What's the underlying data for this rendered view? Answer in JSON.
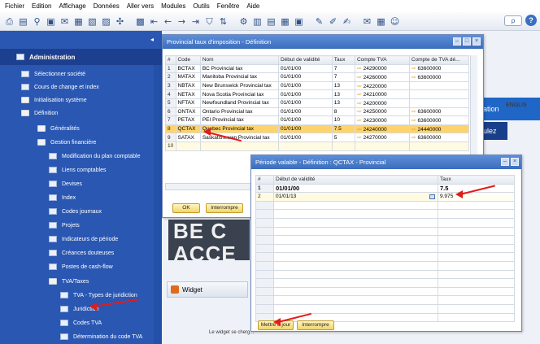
{
  "menu": [
    "Fichier",
    "Edition",
    "Affichage",
    "Données",
    "Aller vers",
    "Modules",
    "Outils",
    "Fenêtre",
    "Aide"
  ],
  "toolbar": {
    "icons": [
      "print-icon",
      "print-preview-icon",
      "find-icon",
      "add-icon",
      "mail-icon",
      "document-icon",
      "document-icon",
      "document-icon",
      "filter-icon",
      "first-record-icon",
      "previous-record-icon",
      "next-record-icon",
      "last-record-icon",
      "filter-funnel-icon",
      "sort-icon",
      "settings-icon",
      "report-icon",
      "chart-icon",
      "edit-icon",
      "note-icon",
      "message-icon",
      "calendar-icon",
      "user-icon"
    ],
    "search_value": "ρ"
  },
  "nav": {
    "collapse_glyph": "◂",
    "header": "Administration",
    "items": [
      "Sélectionner société",
      "Cours de change et index",
      "Initialisation système",
      "Définition",
      "Généralités",
      "Gestion financière",
      "Modification du plan comptable",
      "Liens comptables",
      "Devises",
      "Index",
      "Codes journaux",
      "Projets",
      "Indicateurs de période",
      "Créances douteuses",
      "Postes de cash-flow",
      "TVA/Taxes",
      "TVA - Types de juridiction",
      "Juridiction",
      "Codes TVA",
      "Détermination du code TVA"
    ]
  },
  "background": {
    "blue_tile_text": "ation",
    "english_text": "ENGLIS",
    "dark_tile_text": "ulez",
    "banner_text": "BE C ACCE",
    "widget_title": "Widget",
    "note_text": "Le widget se cherg..."
  },
  "win1": {
    "title": "Provincial taux d'imposition - Définition",
    "columns": [
      "#",
      "Code",
      "Nom",
      "Début de validité",
      "Taux",
      "Compte TVA",
      "Compte de TVA dé..."
    ],
    "rows": [
      {
        "n": "1",
        "code": "BCTAX",
        "nom": "BC Provincial tax",
        "debut": "01/01/00",
        "taux": "7",
        "compte": "24290000",
        "compte2": "63600000"
      },
      {
        "n": "2",
        "code": "MATAX",
        "nom": "Manitoba Provincial tax",
        "debut": "01/01/00",
        "taux": "7",
        "compte": "24260000",
        "compte2": "63600000"
      },
      {
        "n": "3",
        "code": "NBTAX",
        "nom": "New Brunswick Provincial tax",
        "debut": "01/01/00",
        "taux": "13",
        "compte": "24220000",
        "compte2": ""
      },
      {
        "n": "4",
        "code": "NETAX",
        "nom": "Nova Scotia Provincial tax",
        "debut": "01/01/00",
        "taux": "13",
        "compte": "24210000",
        "compte2": ""
      },
      {
        "n": "5",
        "code": "NFTAX",
        "nom": "Newfoundland Provincial tax",
        "debut": "01/01/00",
        "taux": "13",
        "compte": "24200000",
        "compte2": ""
      },
      {
        "n": "6",
        "code": "ONTAX",
        "nom": "Ontario Provincial tax",
        "debut": "01/01/00",
        "taux": "8",
        "compte": "24250000",
        "compte2": "63600000"
      },
      {
        "n": "7",
        "code": "PETAX",
        "nom": "PEI Provincial tax",
        "debut": "01/01/00",
        "taux": "10",
        "compte": "24230000",
        "compte2": "63600000"
      },
      {
        "n": "8",
        "code": "QCTAX",
        "nom": "Quebec Provincial tax",
        "debut": "01/01/00",
        "taux": "7.5",
        "compte": "24240000",
        "compte2": "24440000"
      },
      {
        "n": "9",
        "code": "SATAX",
        "nom": "Saskatchewan Provincial tax",
        "debut": "01/01/00",
        "taux": "5",
        "compte": "24270000",
        "compte2": "63600000"
      },
      {
        "n": "10",
        "code": "",
        "nom": "",
        "debut": "",
        "taux": "",
        "compte": "",
        "compte2": ""
      }
    ],
    "ok_label": "OK",
    "cancel_label": "Interrompre"
  },
  "win2": {
    "title": "Période valable - Définition : QCTAX - Provincial",
    "columns": [
      "#",
      "Début de validité",
      "Taux"
    ],
    "rows": [
      {
        "n": "1",
        "debut": "01/01/00",
        "taux": "7.5"
      },
      {
        "n": "2",
        "debut": "01/01/13",
        "taux": "9.975"
      }
    ],
    "update_label": "Mettre à jour",
    "cancel_label": "Interrompre"
  },
  "colors": {
    "accent": "#2a57b2",
    "selection": "#ffd36b",
    "annotation": "#e21b1b"
  }
}
